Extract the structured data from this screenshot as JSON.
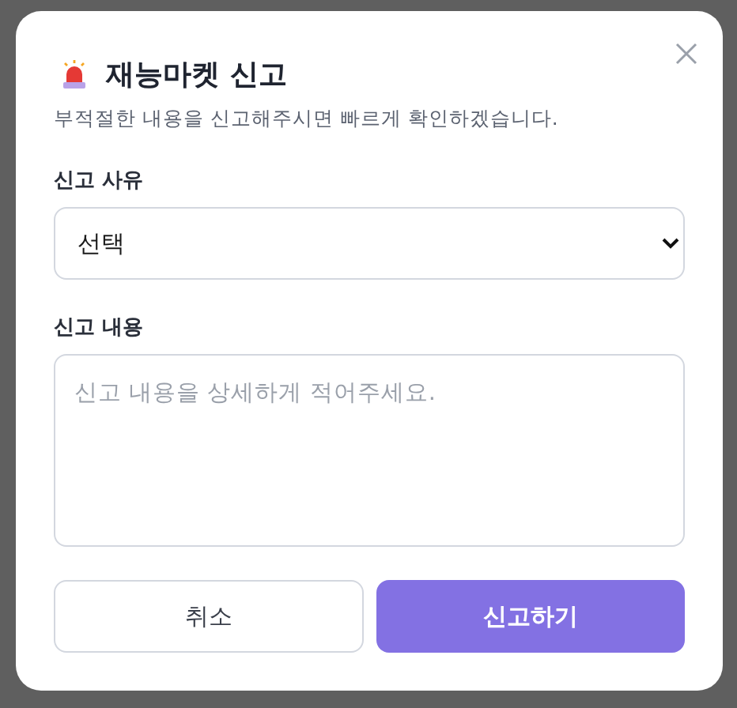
{
  "dialog": {
    "title": "재능마켓 신고",
    "subtitle": "부적절한 내용을 신고해주시면 빠르게 확인하겠습니다.",
    "reason": {
      "label": "신고 사유",
      "value": "선택"
    },
    "details": {
      "label": "신고 내용",
      "placeholder": "신고 내용을 상세하게 적어주세요."
    },
    "buttons": [
      {
        "label": "취소",
        "kind": "secondary"
      },
      {
        "label": "신고하기",
        "kind": "primary"
      }
    ]
  }
}
